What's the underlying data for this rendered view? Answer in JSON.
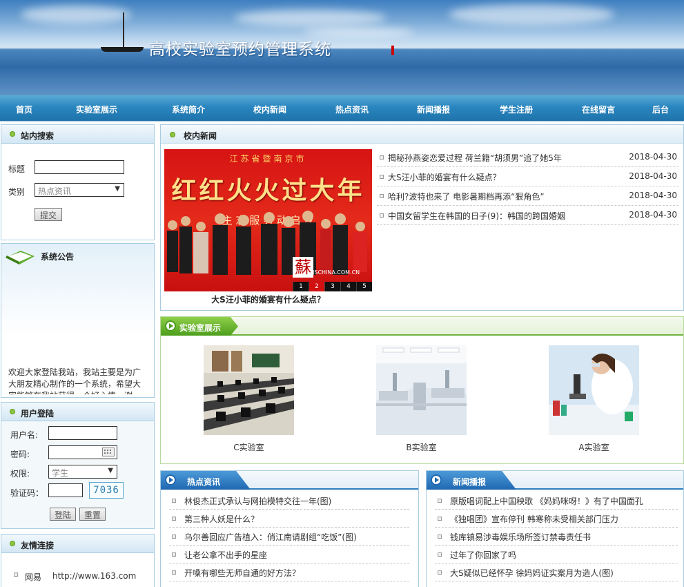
{
  "site": {
    "title": "高校实验室预约管理系统"
  },
  "nav": [
    "首页",
    "实验室展示",
    "系统简介",
    "校内新闻",
    "热点资讯",
    "新闻播报",
    "学生注册",
    "在线留言",
    "后台"
  ],
  "search": {
    "heading": "站内搜索",
    "title_label": "标题",
    "title_value": "",
    "category_label": "类别",
    "category_selected": "热点资讯",
    "submit_label": "提交"
  },
  "notice": {
    "heading": "系统公告",
    "text": "欢迎大家登陆我站，我站主要是为广大朋友精心制作的一个系统，希望大家能够在我站获得一个好心情，谢谢！"
  },
  "login": {
    "heading": "用户登陆",
    "username_label": "用户名:",
    "password_label": "密码:",
    "role_label": "权限:",
    "role_selected": "学生",
    "captcha_label": "验证码：",
    "captcha_code": "7036",
    "login_label": "登陆",
    "reset_label": "重置"
  },
  "links": {
    "heading": "友情连接",
    "items": [
      {
        "name": "网易",
        "url": "http://www.163.com"
      }
    ]
  },
  "campus_news": {
    "heading": "校内新闻",
    "caption": "大S汪小菲的婚宴有什么疑点？",
    "slider_pages": [
      "1",
      "2",
      "3",
      "4",
      "5"
    ],
    "slider_active": 2,
    "photo_banner_top": "江苏省暨南京市",
    "photo_banner_main": "红红火火过大年",
    "photo_banner_sub": "主 志 服 务 动 启 仪",
    "photo_logo": "蘇",
    "photo_site": "JSCHINA.COM.CN",
    "items": [
      {
        "title": "揭秘孙燕姿恋爱过程 荷兰籍“胡须男”追了她5年",
        "date": "2018-04-30"
      },
      {
        "title": "大S汪小菲的婚宴有什么疑点？",
        "date": "2018-04-30"
      },
      {
        "title": "哈利?波特也来了 电影暑期档再添“狠角色”",
        "date": "2018-04-30"
      },
      {
        "title": "中国女留学生在韩国的日子(9)：韩国的跨国婚姻",
        "date": "2018-04-30"
      }
    ]
  },
  "labs": {
    "heading": "实验室展示",
    "items": [
      {
        "name": "C实验室"
      },
      {
        "name": "B实验室"
      },
      {
        "name": "A实验室"
      }
    ]
  },
  "hot_news": {
    "heading": "热点资讯",
    "items": [
      "林俊杰正式承认与网拍模特交往一年(图)",
      "第三种人妖是什么？",
      "乌尔善回应广告植入：俏江南请剧组“吃饭”(图)",
      "让老公拿不出手的星座",
      "开嗓有哪些无师自通的好方法？"
    ]
  },
  "broadcast": {
    "heading": "新闻播报",
    "items": [
      "原版唱词配上中国秧歌 《妈妈咪呀！》有了中国面孔",
      "《独唱团》宣布停刊 韩寒称未受相关部门压力",
      "钱库镇易涉毒娱乐场所签订禁毒责任书",
      "过年了你回家了吗",
      "大S疑似已经怀孕 徐妈妈证实案月为造人(图)"
    ]
  },
  "colors": {
    "nav": "#1f73aa",
    "accent_green": "#6db33f",
    "tab_blue": "#2f7fc0"
  }
}
